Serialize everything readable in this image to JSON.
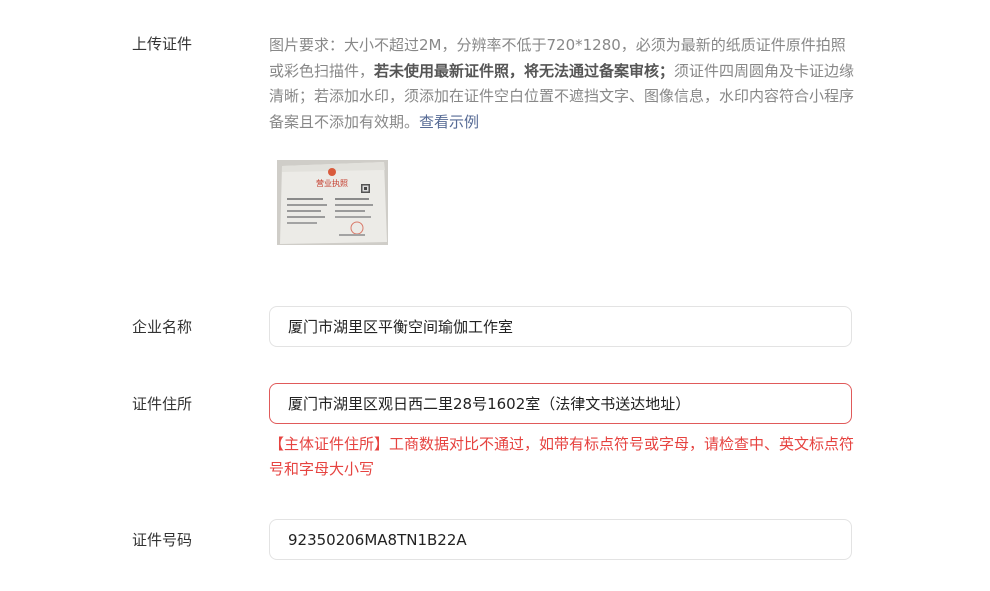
{
  "upload": {
    "label": "上传证件",
    "desc_part1": "图片要求：大小不超过2M，分辨率不低于720*1280，必须为最新的纸质证件原件拍照或彩色扫描件，",
    "desc_bold": "若未使用最新证件照，将无法通过备案审核；",
    "desc_part2": "须证件四周圆角及卡证边缘清晰；若添加水印，须添加在证件空白位置不遮挡文字、图像信息，水印内容符合小程序备案且不添加有效期。",
    "example_link": "查看示例",
    "thumbnail_title": "营业执照"
  },
  "company_name": {
    "label": "企业名称",
    "value": "厦门市湖里区平衡空间瑜伽工作室"
  },
  "address": {
    "label": "证件住所",
    "value": "厦门市湖里区观日西二里28号1602室（法律文书送达地址）",
    "error": "【主体证件住所】工商数据对比不通过，如带有标点符号或字母，请检查中、英文标点符号和字母大小写"
  },
  "cert_number": {
    "label": "证件号码",
    "value": "92350206MA8TN1B22A"
  },
  "colors": {
    "error": "#e64340",
    "link": "#576b95",
    "border": "#e3e3e3"
  }
}
